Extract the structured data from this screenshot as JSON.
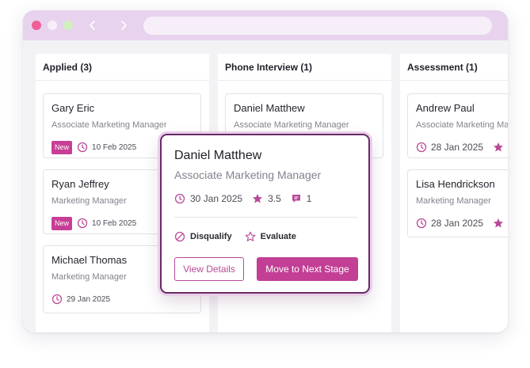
{
  "browser": {
    "url": ""
  },
  "colors": {
    "accent": "#c23f95",
    "accent_outline": "#b84a97",
    "titlebar": "#e8d3ee"
  },
  "columns": [
    {
      "title": "Applied (3)",
      "cards": [
        {
          "name": "Gary Eric",
          "role": "Associate Marketing Manager",
          "badge": "New",
          "date": "10 Feb 2025"
        },
        {
          "name": "Ryan Jeffrey",
          "role": "Marketing Manager",
          "badge": "New",
          "date": "10 Feb 2025"
        },
        {
          "name": "Michael Thomas",
          "role": "Marketing Manager",
          "badge": "",
          "date": "29 Jan 2025"
        }
      ]
    },
    {
      "title": "Phone Interview (1)",
      "cards": [
        {
          "name": "Daniel Matthew",
          "role": "Associate Marketing Manager"
        }
      ]
    },
    {
      "title": "Assessment (1)",
      "cards": [
        {
          "name": "Andrew Paul",
          "role": "Associate Marketing Manager",
          "date": "28 Jan 2025"
        },
        {
          "name": "Lisa Hendrickson",
          "role": "Marketing Manager",
          "date": "28 Jan 2025"
        }
      ]
    }
  ],
  "popover": {
    "name": "Daniel Matthew",
    "role": "Associate Marketing Manager",
    "date": "30 Jan 2025",
    "rating": "3.5",
    "comments": "1",
    "disqualify_label": "Disqualify",
    "evaluate_label": "Evaluate",
    "view_details_label": "View Details",
    "next_stage_label": "Move to Next Stage"
  },
  "icons": {
    "date": "clock-icon",
    "rating": "star-icon",
    "comments": "comment-icon",
    "disqualify": "ban-icon",
    "evaluate": "star-outline-icon"
  }
}
